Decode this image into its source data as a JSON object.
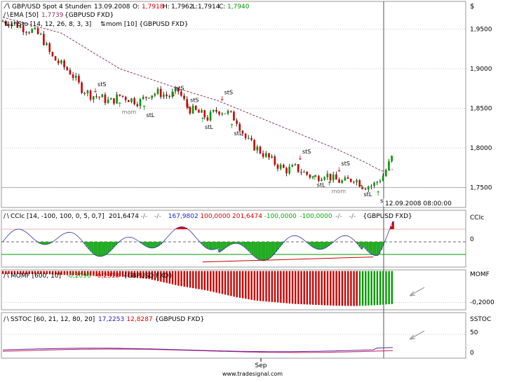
{
  "chart_data": [
    {
      "type": "candlestick",
      "title": "GBP/USD Spot 4 Stunden",
      "date": "13.09.2008",
      "ohlc_readout": {
        "open_label": "O:",
        "open": "1,7918",
        "high_label": "H:",
        "high": "1,7962",
        "low_label": "L:",
        "low": "1,7914",
        "close_label": "C:",
        "close": "1,7940"
      },
      "overlays": [
        {
          "label": "EMA [50]",
          "value": "1,7739",
          "source": "{GBPUSD FXD}"
        },
        {
          "label": "1hSto [14, 12, 26, 8, 3, 3]",
          "label2": "mom [10] {GBPUSD FXD}"
        }
      ],
      "y_unit": "$",
      "y_ticks": [
        "1,9500",
        "1,9000",
        "1,8500",
        "1,8000",
        "1,7500"
      ],
      "y_tick_values": [
        1.95,
        1.9,
        1.85,
        1.8,
        1.75
      ],
      "ylim": [
        1.725,
        1.985
      ],
      "cursor_label": "12.09.2008 08:00:00",
      "signal_labels": [
        "mom",
        "stS",
        "stL"
      ],
      "candles_anchor": [
        [
          0,
          1.96
        ],
        [
          10,
          1.958
        ],
        [
          20,
          1.952
        ],
        [
          30,
          1.948
        ],
        [
          40,
          1.94
        ],
        [
          50,
          1.915
        ],
        [
          60,
          1.905
        ],
        [
          70,
          1.895
        ],
        [
          80,
          1.876
        ],
        [
          90,
          1.867
        ],
        [
          100,
          1.864
        ],
        [
          110,
          1.858
        ],
        [
          120,
          1.866
        ],
        [
          130,
          1.862
        ],
        [
          140,
          1.858
        ],
        [
          150,
          1.868
        ],
        [
          160,
          1.87
        ],
        [
          170,
          1.865
        ],
        [
          180,
          1.872
        ],
        [
          190,
          1.85
        ],
        [
          200,
          1.845
        ],
        [
          210,
          1.838
        ],
        [
          220,
          1.848
        ],
        [
          230,
          1.845
        ],
        [
          240,
          1.835
        ],
        [
          250,
          1.81
        ],
        [
          260,
          1.8
        ],
        [
          270,
          1.79
        ],
        [
          280,
          1.78
        ],
        [
          290,
          1.772
        ],
        [
          300,
          1.775
        ],
        [
          310,
          1.768
        ],
        [
          320,
          1.762
        ],
        [
          330,
          1.768
        ],
        [
          340,
          1.76
        ],
        [
          350,
          1.757
        ],
        [
          360,
          1.762
        ],
        [
          370,
          1.752
        ],
        [
          380,
          1.753
        ],
        [
          390,
          1.765
        ],
        [
          400,
          1.79
        ]
      ],
      "ema_anchor": [
        [
          0,
          1.965
        ],
        [
          60,
          1.945
        ],
        [
          120,
          1.9
        ],
        [
          180,
          1.875
        ],
        [
          220,
          1.86
        ],
        [
          260,
          1.84
        ],
        [
          300,
          1.82
        ],
        [
          340,
          1.8
        ],
        [
          370,
          1.783
        ],
        [
          390,
          1.77
        ],
        [
          400,
          1.773
        ]
      ]
    },
    {
      "type": "line",
      "title": "CCIc [14, -100, 100, 0, 5, 0,7]",
      "values": [
        {
          "text": "201,6474",
          "color": "#000000"
        },
        {
          "text": "-/-",
          "color": "#666666"
        },
        {
          "text": "-/-",
          "color": "#666666"
        },
        {
          "text": "167,9802",
          "color": "#2222cc"
        },
        {
          "text": "100,0000",
          "color": "#dd0000"
        },
        {
          "text": "201,6474",
          "color": "#dd0000"
        },
        {
          "text": "-100,0000",
          "color": "#00aa00"
        },
        {
          "text": "-100,0000",
          "color": "#00aa00"
        },
        {
          "text": "-/-",
          "color": "#666666"
        },
        {
          "text": "-/-",
          "color": "#666666"
        },
        {
          "text": "{GBPUSD FXD}",
          "color": "#000000"
        }
      ],
      "right_label": "CCIc",
      "y_ticks": [
        "0"
      ],
      "ylim": [
        -200,
        250
      ],
      "levels": [
        100,
        0,
        -100
      ]
    },
    {
      "type": "bar",
      "title": "MOMF [600, 10]",
      "values": [
        {
          "text": "-0,2096",
          "color": "#00aa00"
        },
        {
          "text": "-0,2318",
          "color": "#dd0000"
        },
        {
          "text": "{GBPUSD FXD}",
          "color": "#000000"
        }
      ],
      "right_label": "MOMF",
      "y_ticks": [
        "-0,2000"
      ],
      "ylim": [
        -0.245,
        -0.005
      ],
      "histogram_anchor": [
        [
          0,
          -0.03
        ],
        [
          40,
          -0.03
        ],
        [
          60,
          -0.035
        ],
        [
          90,
          -0.04
        ],
        [
          120,
          -0.045
        ],
        [
          150,
          -0.06
        ],
        [
          180,
          -0.1
        ],
        [
          210,
          -0.13
        ],
        [
          240,
          -0.17
        ],
        [
          260,
          -0.19
        ],
        [
          280,
          -0.2
        ],
        [
          300,
          -0.21
        ],
        [
          320,
          -0.215
        ],
        [
          340,
          -0.22
        ],
        [
          360,
          -0.222
        ],
        [
          380,
          -0.218
        ],
        [
          400,
          -0.21
        ]
      ]
    },
    {
      "type": "line",
      "title": "SSTOC [60, 21, 12, 80, 20]",
      "values": [
        {
          "text": "17,2253",
          "color": "#2222cc"
        },
        {
          "text": "12,8287",
          "color": "#dd0000"
        },
        {
          "text": "{GBPUSD FXD}",
          "color": "#000000"
        }
      ],
      "right_label": "SSTOC",
      "y_ticks": [
        "50",
        "0"
      ],
      "ylim": [
        -5,
        100
      ]
    }
  ],
  "x_axis_label": "Sep",
  "footer": "www.tradesignal.com",
  "colors": {
    "up": "#009900",
    "down": "#cc0000",
    "ema": "#883366",
    "cci_pos": "#dd0000",
    "cci_neg": "#22aa22",
    "grid": "#c8c8c8",
    "cci_line": "#3333aa",
    "sstoc_main": "#6622aa",
    "sstoc_signal": "#cc2255"
  }
}
